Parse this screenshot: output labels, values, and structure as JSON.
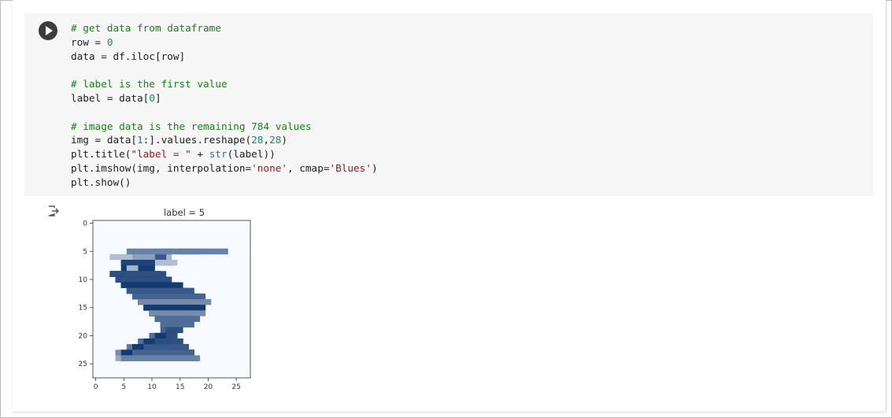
{
  "cell": {
    "code_lines": [
      [
        {
          "t": "# get data from dataframe",
          "c": "com"
        }
      ],
      [
        {
          "t": "row = ",
          "c": "txt"
        },
        {
          "t": "0",
          "c": "num"
        }
      ],
      [
        {
          "t": "data = df.iloc[row]",
          "c": "txt"
        }
      ],
      [],
      [
        {
          "t": "# label is the first value",
          "c": "com"
        }
      ],
      [
        {
          "t": "label = data[",
          "c": "txt"
        },
        {
          "t": "0",
          "c": "num"
        },
        {
          "t": "]",
          "c": "txt"
        }
      ],
      [],
      [
        {
          "t": "# image data is the remaining 784 values",
          "c": "com"
        }
      ],
      [
        {
          "t": "img = data[",
          "c": "txt"
        },
        {
          "t": "1",
          "c": "num"
        },
        {
          "t": ":].values.reshape(",
          "c": "txt"
        },
        {
          "t": "28",
          "c": "num"
        },
        {
          "t": ",",
          "c": "txt"
        },
        {
          "t": "28",
          "c": "num"
        },
        {
          "t": ")",
          "c": "txt"
        }
      ],
      [
        {
          "t": "plt.title(",
          "c": "txt"
        },
        {
          "t": "\"label = \"",
          "c": "str"
        },
        {
          "t": " + ",
          "c": "txt"
        },
        {
          "t": "str",
          "c": "fn"
        },
        {
          "t": "(label))",
          "c": "txt"
        }
      ],
      [
        {
          "t": "plt.imshow(img, interpolation=",
          "c": "txt"
        },
        {
          "t": "'none'",
          "c": "str"
        },
        {
          "t": ", cmap=",
          "c": "txt"
        },
        {
          "t": "'Blues'",
          "c": "str"
        },
        {
          "t": ")",
          "c": "txt"
        }
      ],
      [
        {
          "t": "plt.show()",
          "c": "txt"
        }
      ]
    ]
  },
  "output": {
    "icon": "output-arrow-icon",
    "plot": {
      "title": "label = 5",
      "x_ticks": [
        "0",
        "5",
        "10",
        "15",
        "20",
        "25"
      ],
      "y_ticks": [
        "0",
        "5",
        "10",
        "15",
        "20",
        "25"
      ],
      "cmap": "Blues",
      "grid_size": 28,
      "pixels": [
        [
          13,
          5,
          12,
          0.55
        ],
        [
          13,
          6,
          12,
          0.35
        ],
        [
          15,
          5,
          18,
          0.55
        ],
        [
          16,
          5,
          17,
          0.3
        ],
        [
          12,
          6,
          9,
          0.8
        ],
        [
          12,
          7,
          5,
          0.95
        ],
        [
          13,
          7,
          5,
          0.85
        ],
        [
          14,
          7,
          5,
          0.3
        ],
        [
          7,
          6,
          10,
          0.45
        ],
        [
          6,
          6,
          3,
          0.3
        ],
        [
          23,
          5,
          6,
          0.6
        ],
        [
          5,
          7,
          10,
          0.9
        ],
        [
          5,
          8,
          10,
          0.95
        ],
        [
          5,
          9,
          11,
          0.7
        ],
        [
          7,
          8,
          6,
          0.35
        ],
        [
          7,
          9,
          6,
          0.35
        ],
        [
          9,
          9,
          3,
          0.5
        ],
        [
          10,
          9,
          3,
          0.95
        ],
        [
          11,
          9,
          3,
          0.95
        ],
        [
          12,
          9,
          3,
          0.85
        ],
        [
          10,
          10,
          4,
          0.95
        ],
        [
          11,
          10,
          4,
          0.95
        ],
        [
          12,
          10,
          4,
          0.9
        ],
        [
          13,
          10,
          4,
          0.85
        ],
        [
          12,
          11,
          5,
          0.6
        ],
        [
          13,
          11,
          5,
          0.9
        ],
        [
          14,
          11,
          5,
          0.95
        ],
        [
          15,
          11,
          5,
          0.95
        ],
        [
          14,
          12,
          6,
          0.7
        ],
        [
          15,
          12,
          6,
          0.95
        ],
        [
          16,
          12,
          6,
          0.95
        ],
        [
          17,
          12,
          6,
          0.8
        ],
        [
          16,
          13,
          7,
          0.6
        ],
        [
          17,
          13,
          7,
          0.95
        ],
        [
          18,
          13,
          7,
          0.95
        ],
        [
          19,
          13,
          7,
          0.75
        ],
        [
          17,
          14,
          8,
          0.7
        ],
        [
          18,
          14,
          8,
          0.95
        ],
        [
          19,
          14,
          8,
          0.95
        ],
        [
          20,
          14,
          8,
          0.55
        ],
        [
          17,
          15,
          9,
          0.8
        ],
        [
          18,
          15,
          9,
          0.95
        ],
        [
          19,
          15,
          9,
          0.95
        ],
        [
          16,
          16,
          10,
          0.8
        ],
        [
          17,
          16,
          10,
          0.95
        ],
        [
          18,
          16,
          10,
          0.95
        ],
        [
          19,
          16,
          10,
          0.55
        ],
        [
          15,
          17,
          11,
          0.8
        ],
        [
          16,
          17,
          11,
          0.95
        ],
        [
          17,
          17,
          11,
          0.95
        ],
        [
          18,
          17,
          11,
          0.7
        ],
        [
          14,
          18,
          12,
          0.7
        ],
        [
          15,
          18,
          12,
          0.95
        ],
        [
          16,
          18,
          12,
          0.95
        ],
        [
          17,
          18,
          12,
          0.7
        ],
        [
          12,
          19,
          13,
          0.75
        ],
        [
          13,
          19,
          13,
          0.95
        ],
        [
          14,
          19,
          13,
          0.95
        ],
        [
          15,
          19,
          13,
          0.85
        ],
        [
          10,
          20,
          14,
          0.7
        ],
        [
          11,
          20,
          14,
          0.95
        ],
        [
          12,
          20,
          14,
          0.95
        ],
        [
          13,
          20,
          14,
          0.85
        ],
        [
          8,
          21,
          15,
          0.7
        ],
        [
          9,
          21,
          15,
          0.95
        ],
        [
          10,
          21,
          15,
          0.95
        ],
        [
          11,
          21,
          15,
          0.85
        ],
        [
          6,
          22,
          16,
          0.65
        ],
        [
          7,
          22,
          16,
          0.95
        ],
        [
          8,
          22,
          16,
          0.95
        ],
        [
          9,
          22,
          16,
          0.8
        ],
        [
          4,
          23,
          17,
          0.55
        ],
        [
          5,
          23,
          17,
          0.95
        ],
        [
          6,
          23,
          17,
          0.95
        ],
        [
          7,
          23,
          17,
          0.75
        ],
        [
          4,
          24,
          18,
          0.4
        ],
        [
          5,
          24,
          18,
          0.6
        ]
      ]
    }
  }
}
